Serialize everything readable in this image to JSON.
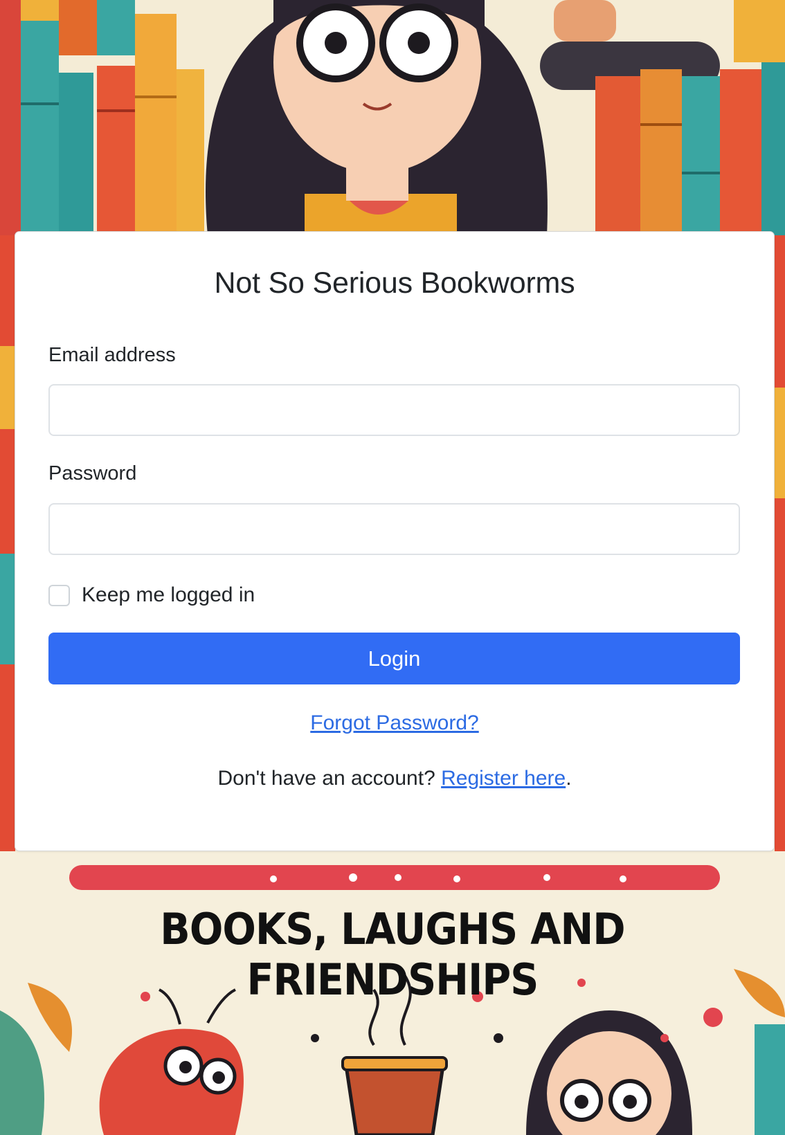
{
  "card": {
    "title": "Not So Serious Bookworms",
    "email_label": "Email address",
    "email_value": "",
    "password_label": "Password",
    "password_value": "",
    "remember_label": "Keep me logged in",
    "login_label": "Login",
    "forgot_link": "Forgot Password?",
    "register_prefix": "Don't have an account? ",
    "register_link": "Register here",
    "register_suffix": "."
  },
  "banner": {
    "tagline": "BOOKS, LAUGHS AND FRIENDSHIPS"
  },
  "colors": {
    "primary": "#316cf4",
    "link": "#2c6be3",
    "text": "#212529",
    "card_bg": "#ffffff"
  },
  "icons": {
    "background": "bookworm-illustration"
  }
}
